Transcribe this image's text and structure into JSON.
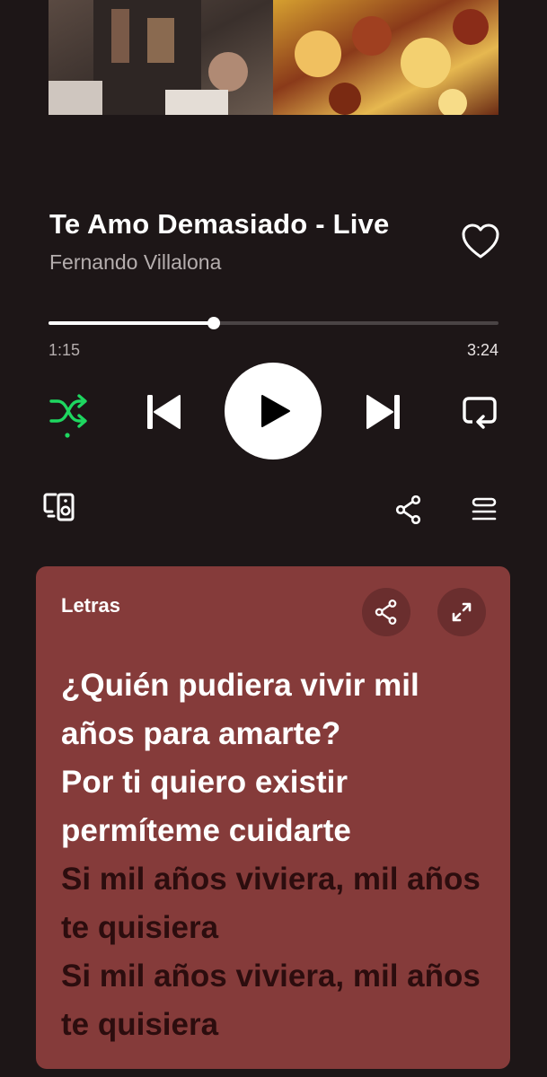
{
  "track": {
    "title": "Te Amo Demasiado - Live",
    "artist": "Fernando Villalona",
    "progress_fraction": 0.367,
    "elapsed": "1:15",
    "duration": "3:24",
    "liked": false
  },
  "controls": {
    "shuffle": {
      "icon": "shuffle-icon",
      "active": true,
      "color": "#1ed760"
    },
    "previous": {
      "icon": "skip-previous-icon"
    },
    "play": {
      "icon": "play-icon",
      "state": "paused"
    },
    "next": {
      "icon": "skip-next-icon"
    },
    "repeat": {
      "icon": "repeat-icon",
      "active": false
    }
  },
  "secondary": {
    "devices": {
      "icon": "connect-devices-icon"
    },
    "share": {
      "icon": "share-icon"
    },
    "queue": {
      "icon": "queue-icon"
    }
  },
  "lyrics": {
    "label": "Letras",
    "card_color": "#853b3a",
    "share_icon": "share-icon",
    "expand_icon": "expand-icon",
    "lines": [
      {
        "text": "¿Quién pudiera vivir mil",
        "state": "active"
      },
      {
        "text": "años para amarte?",
        "state": "active"
      },
      {
        "text": "Por ti quiero existir",
        "state": "active"
      },
      {
        "text": "permíteme cuidarte",
        "state": "active"
      },
      {
        "text": "Si mil años viviera, mil años",
        "state": "upcoming"
      },
      {
        "text": "te quisiera",
        "state": "upcoming"
      },
      {
        "text": "Si mil años viviera, mil años",
        "state": "upcoming"
      },
      {
        "text": "te quisiera",
        "state": "upcoming"
      }
    ]
  },
  "colors": {
    "background": "#1d1617",
    "accent": "#1ed760",
    "secondary_text": "#b5aeae"
  }
}
